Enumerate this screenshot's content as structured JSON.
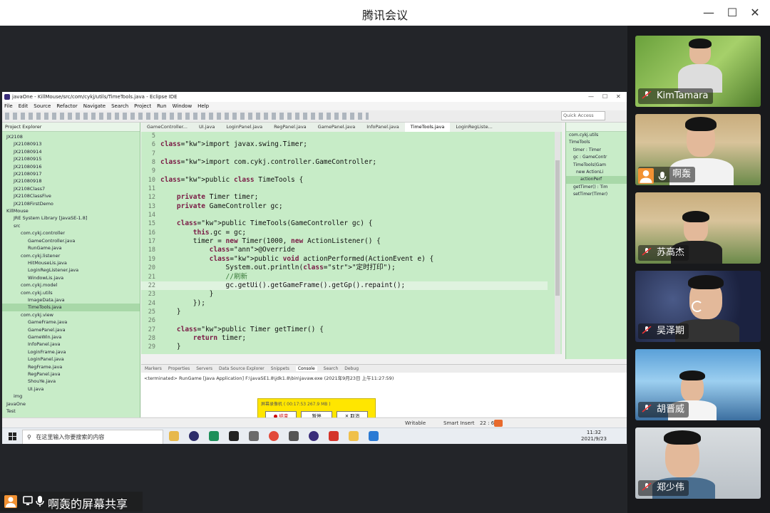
{
  "meeting": {
    "title": "腾讯会议",
    "share_label": "啊轰的屏幕共享"
  },
  "participants": [
    {
      "name": "KimTamara",
      "muted": true
    },
    {
      "name": "啊轰",
      "muted": false
    },
    {
      "name": "苏高杰",
      "muted": true
    },
    {
      "name": "吴泽期",
      "muted": true
    },
    {
      "name": "胡晋威",
      "muted": true
    },
    {
      "name": "郑少伟",
      "muted": true
    }
  ],
  "eclipse": {
    "title": "javaOne - KillMouse/src/com/cykj/utils/TimeTools.java - Eclipse IDE",
    "menu": [
      "File",
      "Edit",
      "Source",
      "Refactor",
      "Navigate",
      "Search",
      "Project",
      "Run",
      "Window",
      "Help"
    ],
    "quick_access": "Quick Access",
    "project_explorer_title": "Project Explorer",
    "tree": [
      "JX2108",
      "JX21080913",
      "JX21080914",
      "JX21080915",
      "JX21080916",
      "JX21080917",
      "JX21080918",
      "JX2108Class7",
      "JX2108ClassFive",
      "JX2108FirstDemo",
      "KillMouse",
      "JRE System Library [JavaSE-1.8]",
      "src",
      "com.cykj.controller",
      "GameController.java",
      "RunGame.java",
      "com.cykj.listener",
      "HitMouseLis.java",
      "LoginRegListener.java",
      "WindowLis.java",
      "com.cykj.model",
      "com.cykj.utils",
      "ImageData.java",
      "TimeTools.java",
      "com.cykj.view",
      "GameFrame.java",
      "GamePanel.java",
      "GameWin.java",
      "InfoPanel.java",
      "LoginFrame.java",
      "LoginPanel.java",
      "RegFrame.java",
      "RegPanel.java",
      "ShouYe.java",
      "UI.java",
      "img",
      "JavaOne",
      "Test"
    ],
    "editor_tabs": [
      "GameController...",
      "UI.java",
      "LoginPanel.java",
      "RegPanel.java",
      "GamePanel.java",
      "InfoPanel.java",
      "TimeTools.java",
      "LoginRegListe..."
    ],
    "code_lines": [
      {
        "n": "5",
        "t": ""
      },
      {
        "n": "6",
        "t": "import javax.swing.Timer;"
      },
      {
        "n": "7",
        "t": ""
      },
      {
        "n": "8",
        "t": "import com.cykj.controller.GameController;"
      },
      {
        "n": "9",
        "t": ""
      },
      {
        "n": "10",
        "t": "public class TimeTools {"
      },
      {
        "n": "11",
        "t": ""
      },
      {
        "n": "12",
        "t": "    private Timer timer;"
      },
      {
        "n": "13",
        "t": "    private GameController gc;"
      },
      {
        "n": "14",
        "t": ""
      },
      {
        "n": "15",
        "t": "    public TimeTools(GameController gc) {"
      },
      {
        "n": "16",
        "t": "        this.gc = gc;"
      },
      {
        "n": "17",
        "t": "        timer = new Timer(1000, new ActionListener() {"
      },
      {
        "n": "18",
        "t": "            @Override"
      },
      {
        "n": "19",
        "t": "            public void actionPerformed(ActionEvent e) {"
      },
      {
        "n": "20",
        "t": "                System.out.println(\"定时打印\");"
      },
      {
        "n": "21",
        "t": "                //刷新"
      },
      {
        "n": "22",
        "t": "                gc.getUi().getGameFrame().getGp().repaint();"
      },
      {
        "n": "23",
        "t": "            }"
      },
      {
        "n": "24",
        "t": "        });"
      },
      {
        "n": "25",
        "t": "    }"
      },
      {
        "n": "26",
        "t": ""
      },
      {
        "n": "27",
        "t": "    public Timer getTimer() {"
      },
      {
        "n": "28",
        "t": "        return timer;"
      },
      {
        "n": "29",
        "t": "    }"
      }
    ],
    "outline": [
      "com.cykj.utils",
      "TimeTools",
      "timer : Timer",
      "gc : GameContr",
      "TimeTools(Gam",
      "new ActionLi",
      "actionPerf",
      "getTimer() : Tim",
      "setTimer(Timer)"
    ],
    "console_tabs": [
      "Markers",
      "Properties",
      "Servers",
      "Data Source Explorer",
      "Snippets",
      "Console",
      "Search",
      "Debug"
    ],
    "console_line": "<terminated> RunGame [Java Application] F:\\javaSE1.8\\jdk1.8\\bin\\javaw.exe (2021年9月23日 上午11:27:59)",
    "status": {
      "writable": "Writable",
      "insert": "Smart Insert",
      "position": "22 : 6"
    },
    "recorder": {
      "title": "屏幕录像机 ( 00:17:53  267.9 MB )",
      "stop": "● 结束",
      "pause": "暂停",
      "cancel": "✕ 取消"
    },
    "taskbar_search": "在这里输入你要搜索的内容",
    "clock_time": "11:32",
    "clock_date": "2021/9/23"
  }
}
